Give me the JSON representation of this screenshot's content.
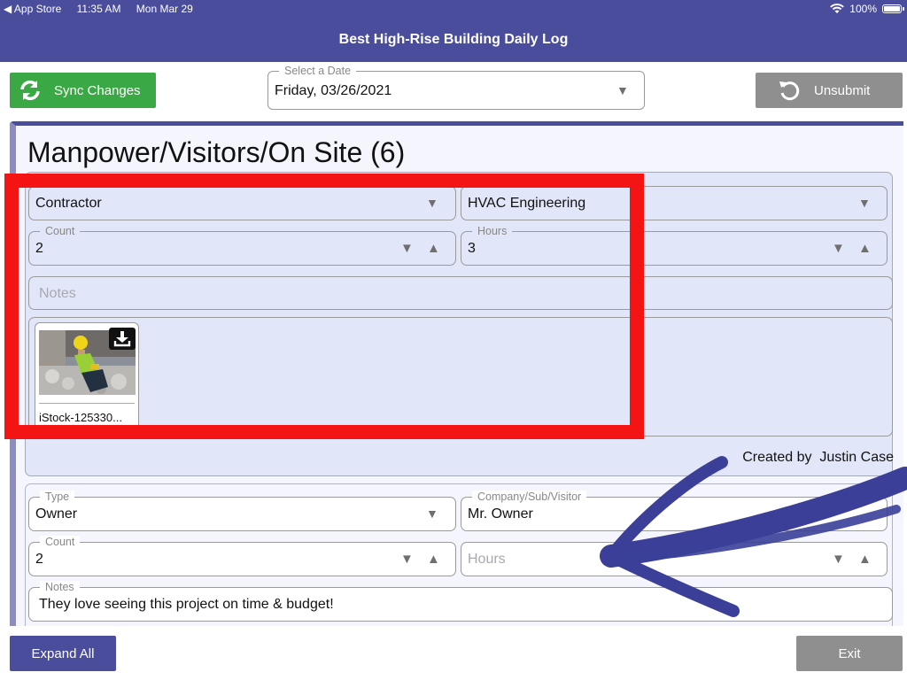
{
  "status_bar": {
    "back_app": "◀ App Store",
    "time": "11:35 AM",
    "date": "Mon Mar 29",
    "battery": "100%"
  },
  "app_title": "Best High-Rise Building Daily Log",
  "toolbar": {
    "sync_label": "Sync Changes",
    "date_legend": "Select a Date",
    "date_value": "Friday, 03/26/2021",
    "unsubmit_label": "Unsubmit"
  },
  "section": {
    "title": "Manpower/Visitors/On Site (6)"
  },
  "entries": [
    {
      "type_value": "Contractor",
      "company_value": "HVAC Engineering",
      "count_label": "Count",
      "count_value": "2",
      "hours_label": "Hours",
      "hours_value": "3",
      "notes_placeholder": "Notes",
      "attachment_name": "iStock-125330...",
      "created_by_label": "Created by",
      "created_by_name": "Justin Case"
    },
    {
      "type_label": "Type",
      "type_value": "Owner",
      "company_label": "Company/Sub/Visitor",
      "company_value": "Mr. Owner",
      "count_label": "Count",
      "count_value": "2",
      "hours_placeholder": "Hours",
      "notes_label": "Notes",
      "notes_value": "They love seeing this project on time & budget!"
    }
  ],
  "footer": {
    "expand_label": "Expand All",
    "exit_label": "Exit"
  },
  "colors": {
    "header": "#4a4d9c",
    "sync_green": "#3aa845",
    "gray_button": "#8f8f8f",
    "entry_bg": "#e1e7f8",
    "annotation_red": "#f41414",
    "annotation_arrow": "#3b3f98"
  },
  "icons": [
    "wifi-icon",
    "battery-icon",
    "sync-icon",
    "undo-icon",
    "dropdown-caret-icon",
    "stepper-down-icon",
    "stepper-up-icon",
    "download-icon",
    "photo-thumbnail"
  ]
}
